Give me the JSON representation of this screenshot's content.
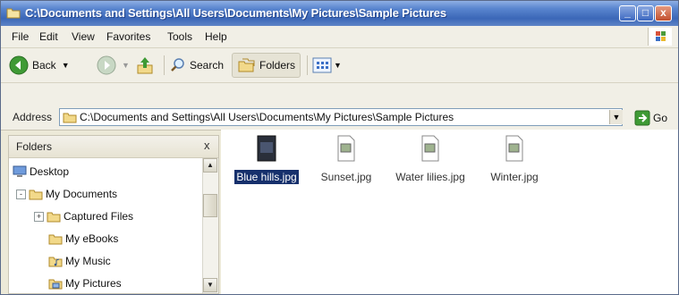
{
  "window": {
    "title": "C:\\Documents and Settings\\All Users\\Documents\\My Pictures\\Sample Pictures",
    "controls": {
      "minimize": "_",
      "maximize": "□",
      "close": "x"
    }
  },
  "menu": [
    "File",
    "Edit",
    "View",
    "Favorites",
    "Tools",
    "Help"
  ],
  "toolbar": {
    "back_label": "Back",
    "search_label": "Search",
    "folders_label": "Folders"
  },
  "address": {
    "label": "Address",
    "value": "C:\\Documents and Settings\\All Users\\Documents\\My Pictures\\Sample Pictures",
    "go_label": "Go"
  },
  "folders_pane": {
    "title": "Folders",
    "close_label": "x",
    "tree": [
      {
        "label": "Desktop",
        "icon": "desktop-icon",
        "expander": ""
      },
      {
        "label": "My Documents",
        "icon": "folder-icon",
        "expander": "-"
      },
      {
        "label": "Captured Files",
        "icon": "folder-icon",
        "expander": "+"
      },
      {
        "label": "My eBooks",
        "icon": "folder-icon",
        "expander": ""
      },
      {
        "label": "My Music",
        "icon": "music-folder-icon",
        "expander": ""
      },
      {
        "label": "My Pictures",
        "icon": "pictures-folder-icon",
        "expander": ""
      }
    ]
  },
  "files": [
    {
      "name": "Blue hills.jpg",
      "selected": true,
      "icon": "image-file-icon"
    },
    {
      "name": "Sunset.jpg",
      "selected": false,
      "icon": "image-file-icon"
    },
    {
      "name": "Water lilies.jpg",
      "selected": false,
      "icon": "image-file-icon"
    },
    {
      "name": "Winter.jpg",
      "selected": false,
      "icon": "image-file-icon"
    }
  ],
  "colors": {
    "titlebar": "#3b67b8",
    "selection": "#16306c",
    "chrome": "#f1efe6"
  }
}
